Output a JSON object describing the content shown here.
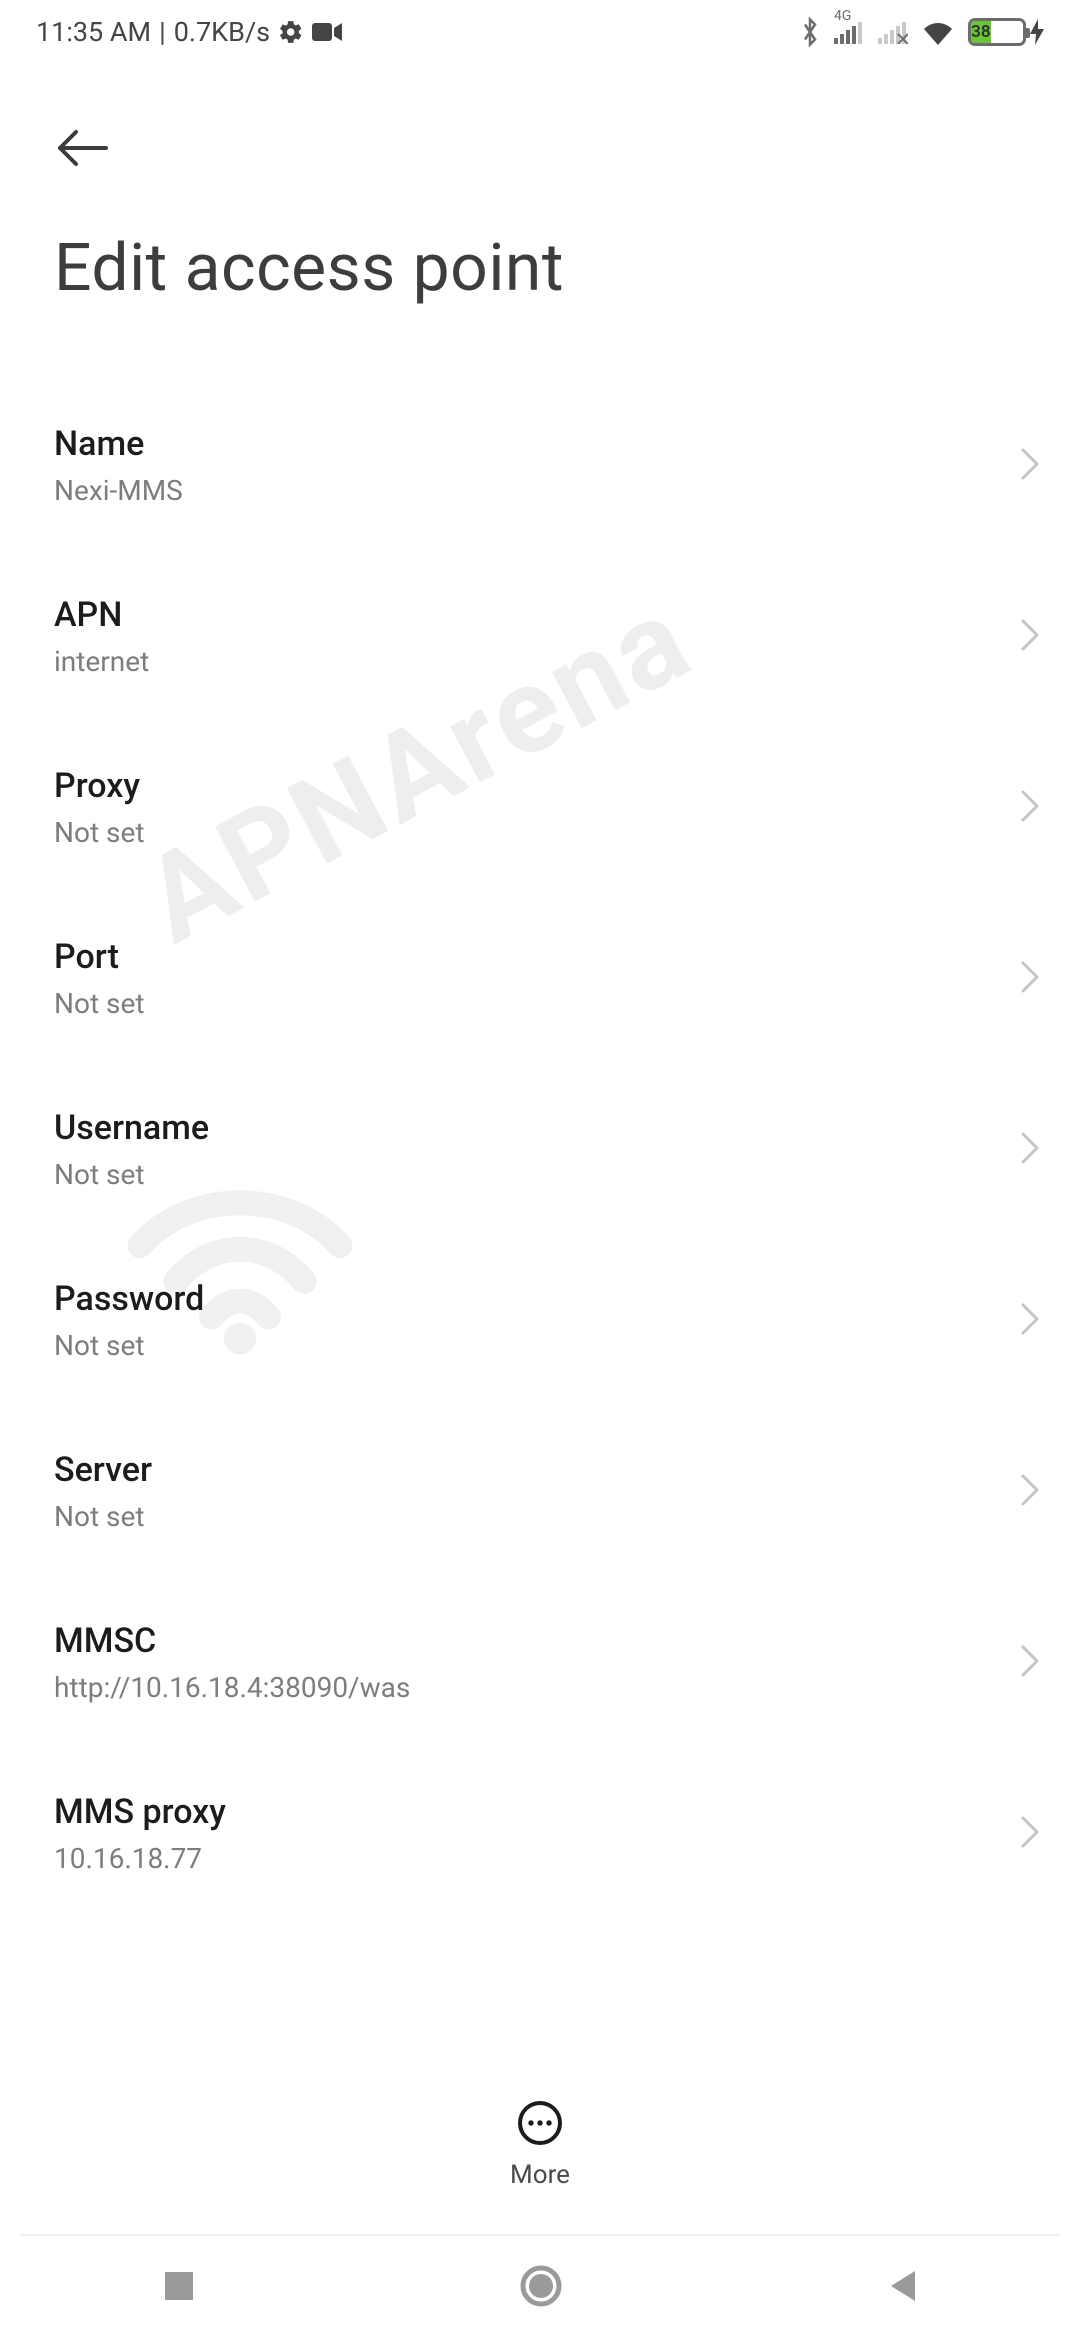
{
  "status": {
    "time": "11:35 AM",
    "speed": "0.7KB/s",
    "signal_label": "4G",
    "battery_pct": "38"
  },
  "page": {
    "title": "Edit access point"
  },
  "more": {
    "label": "More"
  },
  "watermark": {
    "text": "APNArena"
  },
  "rows": [
    {
      "title": "Name",
      "value": "Nexi-MMS"
    },
    {
      "title": "APN",
      "value": "internet"
    },
    {
      "title": "Proxy",
      "value": "Not set"
    },
    {
      "title": "Port",
      "value": "Not set"
    },
    {
      "title": "Username",
      "value": "Not set"
    },
    {
      "title": "Password",
      "value": "Not set"
    },
    {
      "title": "Server",
      "value": "Not set"
    },
    {
      "title": "MMSC",
      "value": "http://10.16.18.4:38090/was"
    },
    {
      "title": "MMS proxy",
      "value": "10.16.18.77"
    }
  ]
}
